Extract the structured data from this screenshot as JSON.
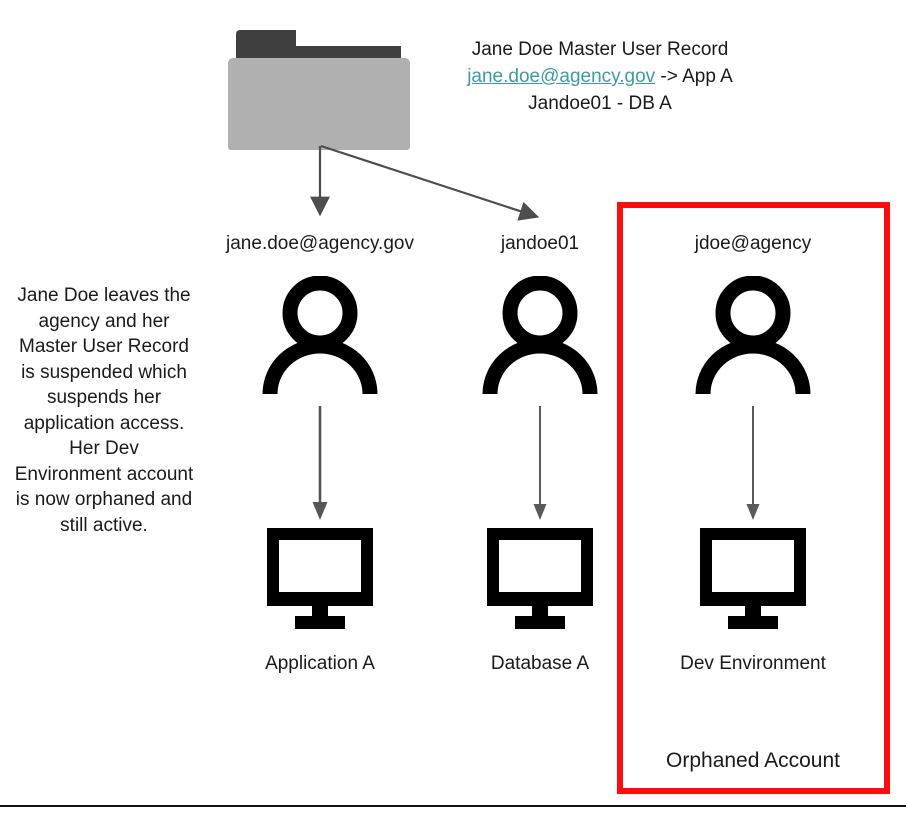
{
  "diagram": {
    "title_block": {
      "line1": "Jane Doe Master User Record",
      "line2_link": "jane.doe@agency.gov",
      "line2_rest": " -> App A",
      "line3": "Jandoe01 - DB A",
      "link_color": "#3d99a6"
    },
    "source_icon": {
      "name": "folder-icon",
      "tab_color": "#3f3f3f",
      "body_color": "#b0b0b0"
    },
    "left_note": "Jane Doe leaves the agency and her Master User Record is suspended which suspends her application access. Her Dev Environment account is now orphaned and still active.",
    "highlight_box": {
      "color": "#fc0d0d",
      "caption": "Orphaned Account"
    },
    "columns": [
      {
        "account_label": "jane.doe@agency.gov",
        "person_icon": "person-icon",
        "arrow_icon": "down-arrow-icon",
        "system_icon": "monitor-icon",
        "system_label": "Application A",
        "highlighted": false
      },
      {
        "account_label": "jandoe01",
        "person_icon": "person-icon",
        "arrow_icon": "down-arrow-icon",
        "system_icon": "monitor-icon",
        "system_label": "Database A",
        "highlighted": false
      },
      {
        "account_label": "jdoe@agency",
        "person_icon": "person-icon",
        "arrow_icon": "down-arrow-icon",
        "system_icon": "monitor-icon",
        "system_label": "Dev Environment",
        "highlighted": true
      }
    ],
    "branch_arrows": {
      "count": 2,
      "color": "#4d4d4d",
      "description": "two arrows from folder to first and second account"
    }
  }
}
